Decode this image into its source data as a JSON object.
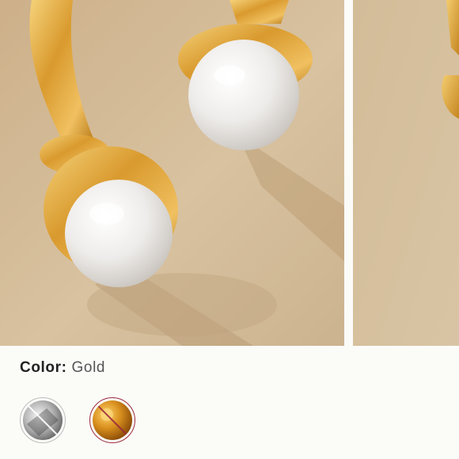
{
  "product": {
    "color_label": "Color:",
    "color_value": "Gold"
  },
  "gallery": {
    "images": [
      {
        "name": "product-image-main",
        "description_icon": "pearl-earrings-photo"
      },
      {
        "name": "product-image-next",
        "description_icon": "pearl-earrings-photo"
      }
    ]
  },
  "swatches": [
    {
      "name": "swatch-silver",
      "icon": "silver-swatch-icon",
      "state": "unavailable",
      "selected": false
    },
    {
      "name": "swatch-gold",
      "icon": "gold-swatch-icon",
      "state": "unavailable",
      "selected": true
    }
  ],
  "colors": {
    "background": "#fbfbf8",
    "photo_background": "#d6bf9d",
    "gold": "#d9a441",
    "pearl": "#f4f2ee",
    "selected_border": "#9c2b3b"
  }
}
